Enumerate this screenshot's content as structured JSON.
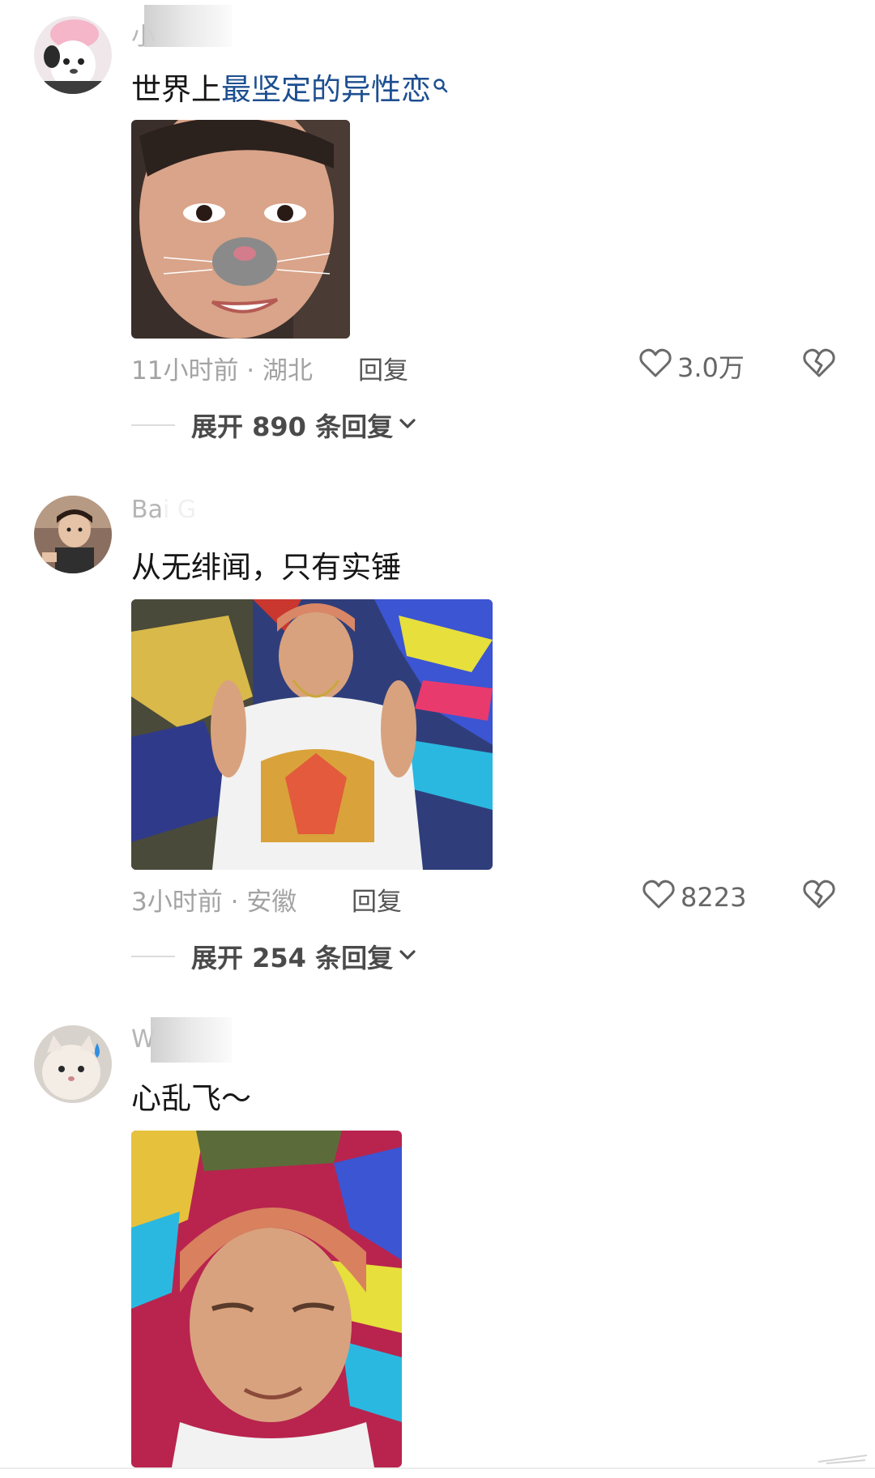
{
  "comments": [
    {
      "username": "小",
      "text_plain": "世界上",
      "text_link": "最坚定的异性恋",
      "time_location": "11小时前 · 湖北",
      "reply_label": "回复",
      "like_count": "3.0万",
      "expand_label": "展开 890 条回复"
    },
    {
      "username": "Bai G",
      "text_plain": "从无绯闻，只有实锤",
      "text_link": "",
      "time_location": "3小时前 · 安徽",
      "reply_label": "回复",
      "like_count": "8223",
      "expand_label": "展开 254 条回复"
    },
    {
      "username": "W",
      "text_plain": "心乱飞～",
      "text_link": ""
    }
  ],
  "icons": {
    "like": "heart-outline-icon",
    "dislike": "broken-heart-icon",
    "expand": "chevron-down-icon",
    "search": "search-icon"
  },
  "colors": {
    "link": "#1d4f91",
    "meta": "#a3a3a3",
    "background": "#ffffff"
  }
}
